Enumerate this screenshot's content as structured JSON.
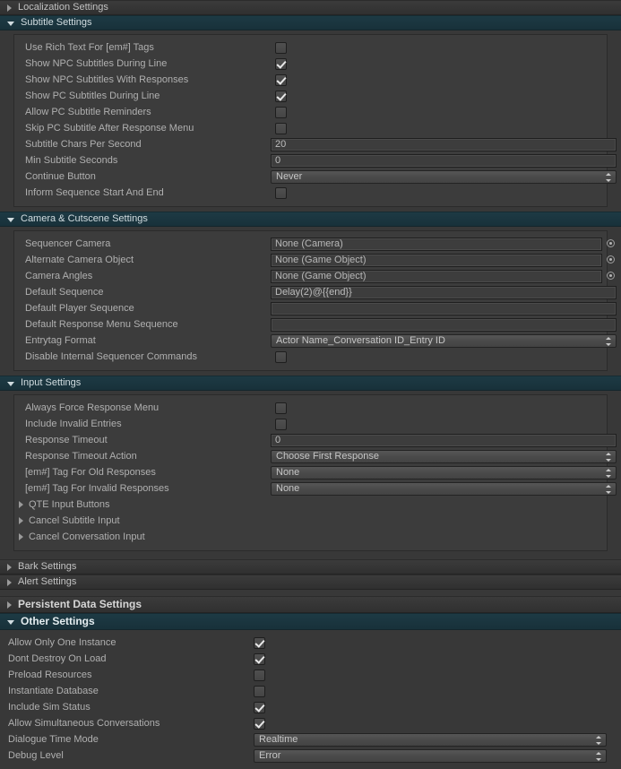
{
  "window": {
    "background": "#383838",
    "accent_open_header": "#1d3a44",
    "label_color": "#b0b0b0"
  },
  "sections": [
    {
      "id": "localization",
      "title": "Localization Settings",
      "expanded": false,
      "major": false
    },
    {
      "id": "subtitle",
      "title": "Subtitle Settings",
      "expanded": true,
      "major": false,
      "rows": [
        {
          "label": "Use Rich Text For [em#] Tags",
          "type": "checkbox",
          "value": false
        },
        {
          "label": "Show NPC Subtitles During Line",
          "type": "checkbox",
          "value": true
        },
        {
          "label": "Show NPC Subtitles With Responses",
          "type": "checkbox",
          "value": true
        },
        {
          "label": "Show PC Subtitles During Line",
          "type": "checkbox",
          "value": true
        },
        {
          "label": "Allow PC Subtitle Reminders",
          "type": "checkbox",
          "value": false
        },
        {
          "label": "Skip PC Subtitle After Response Menu",
          "type": "checkbox",
          "value": false
        },
        {
          "label": "Subtitle Chars Per Second",
          "type": "text",
          "value": "20"
        },
        {
          "label": "Min Subtitle Seconds",
          "type": "text",
          "value": "0"
        },
        {
          "label": "Continue Button",
          "type": "popup",
          "value": "Never"
        },
        {
          "label": "Inform Sequence Start And End",
          "type": "checkbox",
          "value": false
        }
      ]
    },
    {
      "id": "camera",
      "title": "Camera & Cutscene Settings",
      "expanded": true,
      "major": false,
      "rows": [
        {
          "label": "Sequencer Camera",
          "type": "object",
          "value": "None (Camera)"
        },
        {
          "label": "Alternate Camera Object",
          "type": "object",
          "value": "None (Game Object)"
        },
        {
          "label": "Camera Angles",
          "type": "object",
          "value": "None (Game Object)"
        },
        {
          "label": "Default Sequence",
          "type": "text",
          "value": "Delay(2)@{{end}}"
        },
        {
          "label": "Default Player Sequence",
          "type": "text",
          "value": ""
        },
        {
          "label": "Default Response Menu Sequence",
          "type": "text",
          "value": ""
        },
        {
          "label": "Entrytag Format",
          "type": "popup",
          "value": "Actor Name_Conversation ID_Entry ID"
        },
        {
          "label": "Disable Internal Sequencer Commands",
          "type": "checkbox",
          "value": false
        }
      ]
    },
    {
      "id": "input",
      "title": "Input Settings",
      "expanded": true,
      "major": false,
      "rows": [
        {
          "label": "Always Force Response Menu",
          "type": "checkbox",
          "value": false
        },
        {
          "label": "Include Invalid Entries",
          "type": "checkbox",
          "value": false
        },
        {
          "label": "Response Timeout",
          "type": "text",
          "value": "0"
        },
        {
          "label": "Response Timeout Action",
          "type": "popup",
          "value": "Choose First Response"
        },
        {
          "label": "[em#] Tag For Old Responses",
          "type": "popup",
          "value": "None"
        },
        {
          "label": "[em#] Tag For Invalid Responses",
          "type": "popup",
          "value": "None"
        },
        {
          "label": "QTE Input Buttons",
          "type": "foldout",
          "value": false
        },
        {
          "label": "Cancel Subtitle Input",
          "type": "foldout",
          "value": false
        },
        {
          "label": "Cancel Conversation Input",
          "type": "foldout",
          "value": false
        }
      ]
    },
    {
      "id": "bark",
      "title": "Bark Settings",
      "expanded": false,
      "major": false
    },
    {
      "id": "alert",
      "title": "Alert Settings",
      "expanded": false,
      "major": false
    },
    {
      "id": "persistent",
      "title": "Persistent Data Settings",
      "expanded": false,
      "major": true
    },
    {
      "id": "other",
      "title": "Other Settings",
      "expanded": true,
      "major": true,
      "rows": [
        {
          "label": "Allow Only One Instance",
          "type": "checkbox",
          "value": true
        },
        {
          "label": "Dont Destroy On Load",
          "type": "checkbox",
          "value": true
        },
        {
          "label": "Preload Resources",
          "type": "checkbox",
          "value": false
        },
        {
          "label": "Instantiate Database",
          "type": "checkbox",
          "value": false
        },
        {
          "label": "Include Sim Status",
          "type": "checkbox",
          "value": true
        },
        {
          "label": "Allow Simultaneous Conversations",
          "type": "checkbox",
          "value": true
        },
        {
          "label": "Dialogue Time Mode",
          "type": "popup",
          "value": "Realtime"
        },
        {
          "label": "Debug Level",
          "type": "popup",
          "value": "Error"
        }
      ]
    }
  ]
}
